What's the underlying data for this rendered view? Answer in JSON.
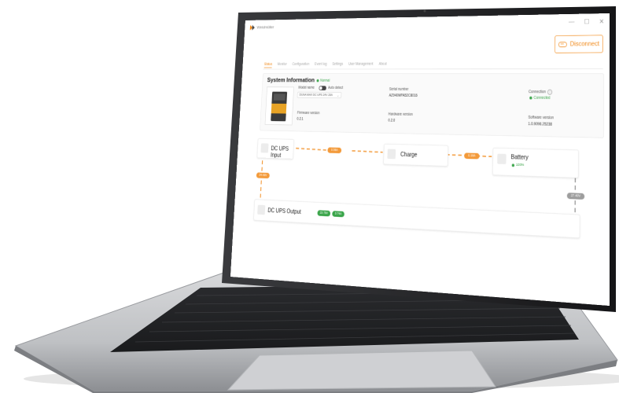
{
  "window": {
    "app_name": "Weidmüller",
    "minimize": "—",
    "maximize": "☐",
    "close": "✕"
  },
  "connection_button": {
    "label": "Disconnect",
    "icon": "link-icon"
  },
  "tabs": [
    {
      "label": "Status",
      "active": true
    },
    {
      "label": "Monitor",
      "active": false
    },
    {
      "label": "Configuration",
      "active": false
    },
    {
      "label": "Event log",
      "active": false
    },
    {
      "label": "Settings",
      "active": false
    },
    {
      "label": "User Management",
      "active": false
    },
    {
      "label": "About",
      "active": false
    }
  ],
  "system_info": {
    "title": "System Information",
    "status": "Normal",
    "model_name_label": "Model name",
    "auto_detect_label": "Auto detect",
    "model_name_value": "DUNA MAX DC UPS 24V 20A",
    "serial_label": "Serial number",
    "serial_value": "AZ940MPA52C8016",
    "connection_label": "Connection",
    "connection_value": "Connected",
    "firmware_label": "Firmware version",
    "firmware_value": "0.2.1",
    "hardware_label": "Hardware version",
    "hardware_value": "0.2.0",
    "software_label": "Software version",
    "software_value": "1.0.9096.25238"
  },
  "flow": {
    "input": {
      "label": "DC UPS Input",
      "voltage": "24.43V",
      "current": "0.56A"
    },
    "charge": {
      "label": "Charge",
      "current": "0.16A"
    },
    "battery": {
      "label": "Battery",
      "status": "100%",
      "voltage": "27.40V"
    },
    "output": {
      "label": "DC UPS Output",
      "voltage": "23.79V",
      "current": "0.74A"
    }
  },
  "colors": {
    "accent": "#f08a1c",
    "ok": "#3aa54a",
    "inactive": "#9d9d9d"
  }
}
